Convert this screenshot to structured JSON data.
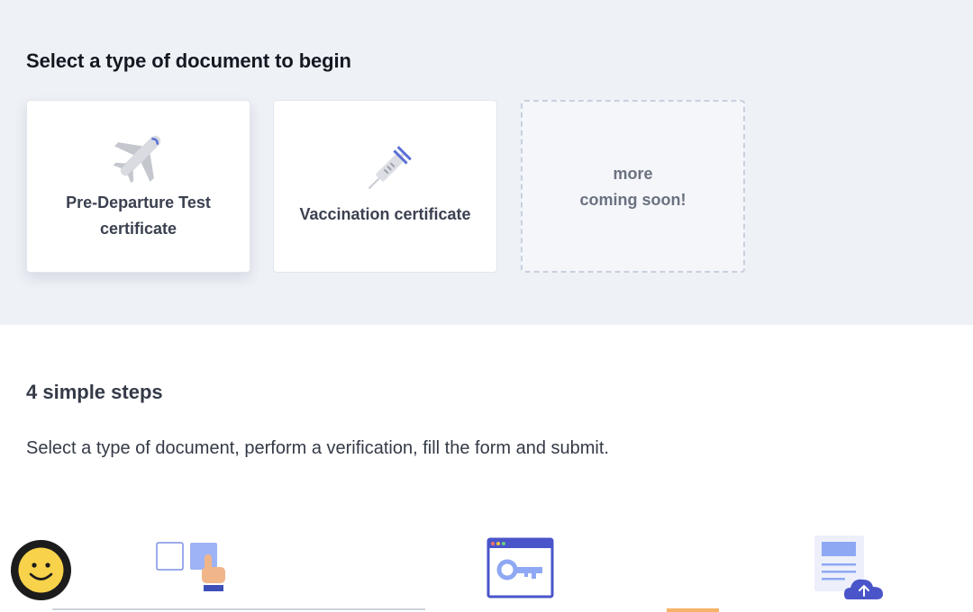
{
  "document_select": {
    "title": "Select a type of document to begin",
    "cards": [
      {
        "label": "Pre-Departure Test\ncertificate",
        "icon": "airplane-icon"
      },
      {
        "label": "Vaccination certificate",
        "icon": "syringe-icon"
      },
      {
        "label": "more\ncoming soon!",
        "icon": ""
      }
    ]
  },
  "steps": {
    "title": "4 simple steps",
    "description": "Select a type of document, perform a verification, fill the form and submit.",
    "icons": [
      "select-document-icon",
      "verification-key-icon",
      "form-upload-icon"
    ]
  },
  "colors": {
    "top_background": "#eef1f6",
    "accent_blue": "#5b6fd6",
    "accent_light_blue": "#9db3f5",
    "chat_button": "#1c1c1c",
    "smiley": "#f7d24a"
  }
}
